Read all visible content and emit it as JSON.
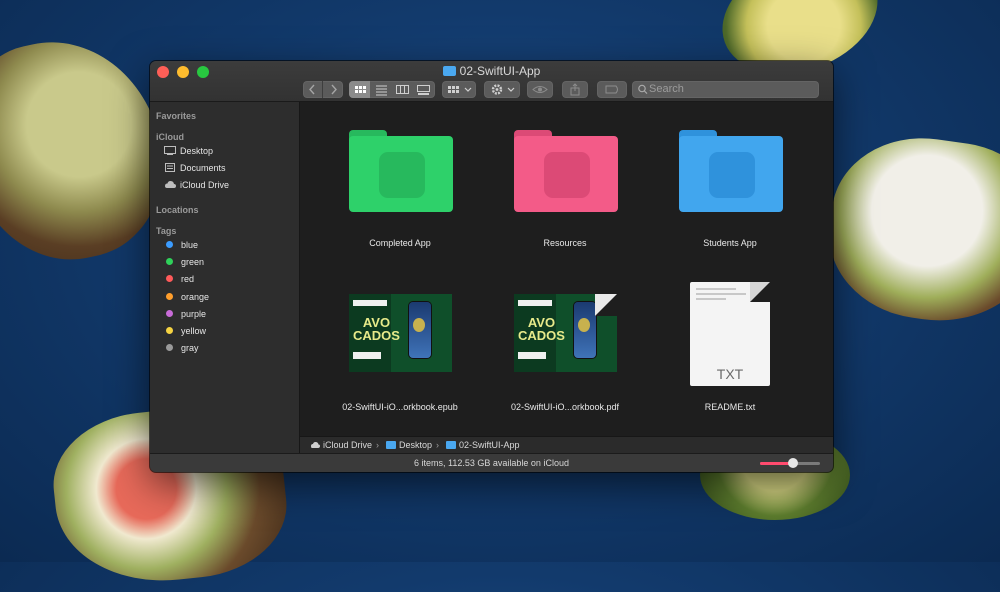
{
  "window": {
    "title": "02-SwiftUI-App",
    "search_placeholder": "Search"
  },
  "sidebar": {
    "favorites_header": "Favorites",
    "icloud_header": "iCloud",
    "icloud_items": [
      {
        "label": "Desktop",
        "icon": "desktop-icon"
      },
      {
        "label": "Documents",
        "icon": "document-icon"
      },
      {
        "label": "iCloud Drive",
        "icon": "cloud-icon"
      }
    ],
    "locations_header": "Locations",
    "tags_header": "Tags",
    "tags": [
      {
        "label": "blue",
        "color": "#3b9cff"
      },
      {
        "label": "green",
        "color": "#2fd15a"
      },
      {
        "label": "red",
        "color": "#ff5a5a"
      },
      {
        "label": "orange",
        "color": "#ff9e2c"
      },
      {
        "label": "purple",
        "color": "#c86bd8"
      },
      {
        "label": "yellow",
        "color": "#f5d342"
      },
      {
        "label": "gray",
        "color": "#9a9a9a"
      }
    ]
  },
  "items": [
    {
      "label": "Completed App",
      "kind": "folder",
      "color": "#2ed16a"
    },
    {
      "label": "Resources",
      "kind": "folder",
      "color": "#f35b88"
    },
    {
      "label": "Students App",
      "kind": "folder",
      "color": "#41a6ee"
    },
    {
      "label": "02-SwiftUI-iO...orkbook.epub",
      "kind": "book"
    },
    {
      "label": "02-SwiftUI-iO...orkbook.pdf",
      "kind": "book"
    },
    {
      "label": "README.txt",
      "kind": "txt",
      "badge": "TXT"
    }
  ],
  "book_cover": {
    "line1": "AVO",
    "line2": "CADOS"
  },
  "pathbar": [
    "iCloud Drive",
    "Desktop",
    "02-SwiftUI-App"
  ],
  "status": {
    "text": "6 items, 112.53 GB available on iCloud",
    "zoom": 0.55
  }
}
